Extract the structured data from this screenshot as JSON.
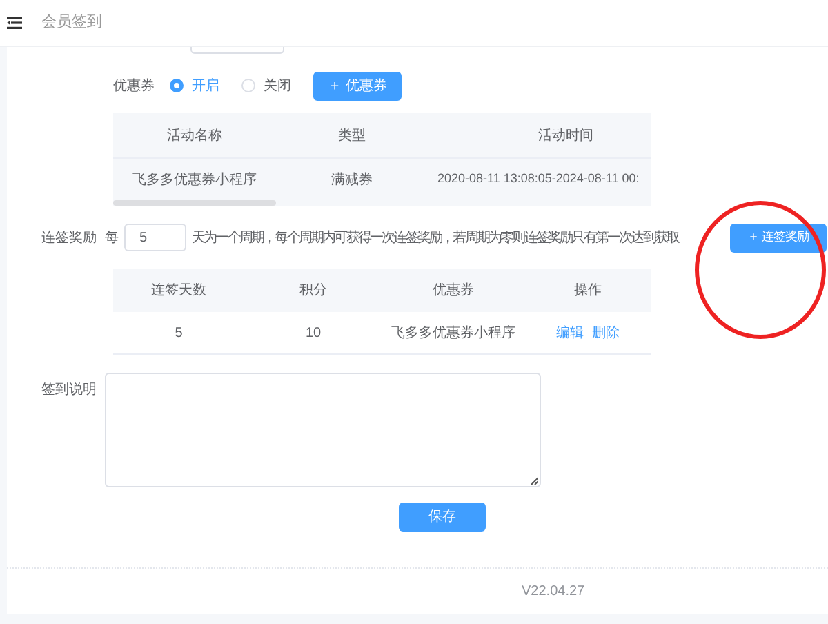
{
  "header": {
    "title": "会员签到"
  },
  "coupon": {
    "label": "优惠券",
    "options": [
      {
        "label": "开启",
        "selected": true
      },
      {
        "label": "关闭",
        "selected": false
      }
    ],
    "add_button": "＋ 优惠券"
  },
  "coupon_table": {
    "columns": [
      "活动名称",
      "类型",
      "活动时间"
    ],
    "rows": [
      [
        "飞多多优惠券小程序",
        "满减券",
        "2020-08-11 13:08:05-2024-08-11 00:"
      ]
    ]
  },
  "streak": {
    "label": "连签奖励",
    "prefix": "每",
    "days_value": "5",
    "description": "天为一个周期，每个周期内可获得一次连签奖励，若周期为零则连签奖励只有第一次达到获取",
    "add_button": "＋ 连签奖励"
  },
  "streak_table": {
    "columns": [
      "连签天数",
      "积分",
      "优惠券",
      "操作"
    ],
    "rows": [
      {
        "days": "5",
        "points": "10",
        "coupon": "飞多多优惠券小程序",
        "actions": [
          "编辑",
          "删除"
        ]
      }
    ]
  },
  "description": {
    "label": "签到说明"
  },
  "save_button": "保存",
  "footer": {
    "version": "V22.04.27"
  }
}
